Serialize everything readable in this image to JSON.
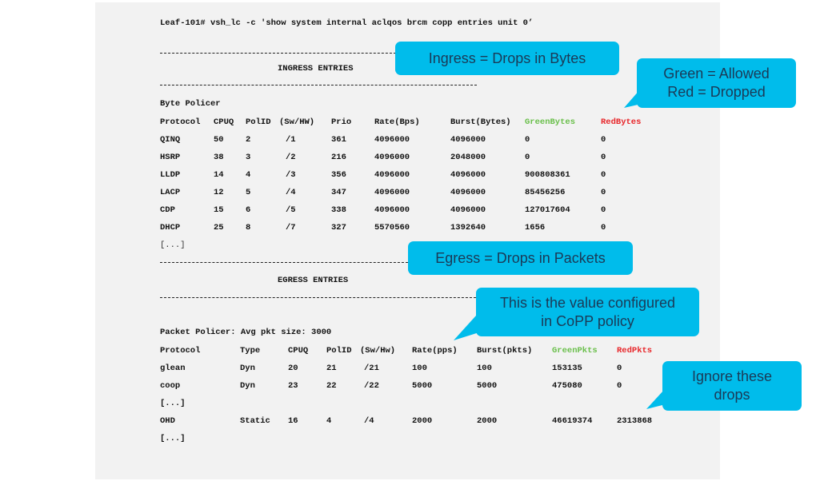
{
  "command": "Leaf-101# vsh_lc -c 'show system internal aclqos brcm copp entries unit 0’",
  "ingress": {
    "section_title": "INGRESS ENTRIES",
    "policer_label": "Byte Policer",
    "headers": [
      "Protocol",
      "CPUQ",
      "PolID",
      "(Sw/HW)",
      "Prio",
      "Rate(Bps)",
      "Burst(Bytes)",
      "GreenBytes",
      "RedBytes"
    ],
    "rows": [
      [
        "QINQ",
        "50",
        "2",
        "/1",
        "361",
        "4096000",
        "4096000",
        "0",
        "0"
      ],
      [
        "HSRP",
        "38",
        "3",
        "/2",
        "216",
        "4096000",
        "2048000",
        "0",
        "0"
      ],
      [
        "LLDP",
        "14",
        "4",
        "/3",
        "356",
        "4096000",
        "4096000",
        "900808361",
        "0"
      ],
      [
        "LACP",
        "12",
        "5",
        "/4",
        "347",
        "4096000",
        "4096000",
        "85456256",
        "0"
      ],
      [
        "CDP",
        "15",
        "6",
        "/5",
        "338",
        "4096000",
        "4096000",
        "127017604",
        "0"
      ],
      [
        "DHCP",
        "25",
        "8",
        "/7",
        "327",
        "5570560",
        "1392640",
        "1656",
        "0"
      ]
    ],
    "ellipsis": "[...]"
  },
  "egress": {
    "section_title": "EGRESS ENTRIES",
    "policer_label": "Packet Policer: Avg pkt size: 3000",
    "headers": [
      "Protocol",
      "Type",
      "CPUQ",
      "PolID",
      "(Sw/Hw)",
      "Rate(pps)",
      "Burst(pkts)",
      "GreenPkts",
      "RedPkts"
    ],
    "rows": [
      [
        "glean",
        "Dyn",
        "20",
        "21",
        "/21",
        "100",
        "100",
        "153135",
        "0"
      ],
      [
        "coop",
        "Dyn",
        "23",
        "22",
        "/22",
        "5000",
        "5000",
        "475080",
        "0"
      ]
    ],
    "ellipsis_1": "[...]",
    "last_row": [
      "OHD",
      "Static",
      "16",
      "4",
      "/4",
      "2000",
      "2000",
      "46619374",
      "2313868"
    ],
    "ellipsis_2": "[...]"
  },
  "callouts": {
    "ingress": "Ingress = Drops in Bytes",
    "legend_line1": "Green = Allowed",
    "legend_line2": "Red = Dropped",
    "egress": "Egress = Drops in Packets",
    "configured_line1": "This is the value configured",
    "configured_line2": "in CoPP policy",
    "ignore_line1": "Ignore these",
    "ignore_line2": "drops"
  },
  "colors": {
    "callout_fill": "#00bceb",
    "callout_text": "#1b3a57",
    "green": "#6abf4b",
    "red": "#e8262a",
    "panel_bg": "#f2f2f2"
  }
}
